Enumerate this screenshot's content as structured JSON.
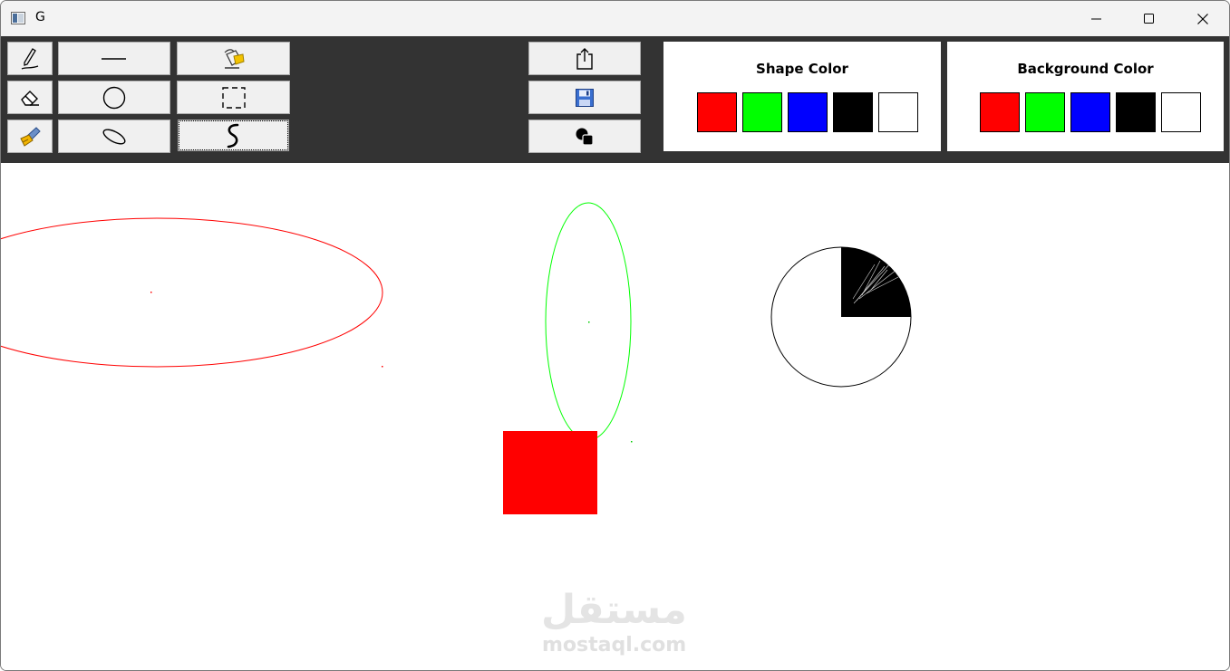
{
  "window": {
    "title": "G"
  },
  "toolbar": {
    "tools": [
      {
        "name": "pencil",
        "icon": "pencil-icon"
      },
      {
        "name": "line",
        "icon": "line-icon"
      },
      {
        "name": "bucket-fill",
        "icon": "paint-bucket-icon"
      },
      {
        "name": "eraser",
        "icon": "eraser-icon"
      },
      {
        "name": "circle",
        "icon": "circle-icon"
      },
      {
        "name": "rectangle-select",
        "icon": "dashed-rectangle-icon"
      },
      {
        "name": "brush",
        "icon": "brush-icon"
      },
      {
        "name": "ellipse",
        "icon": "ellipse-icon"
      },
      {
        "name": "freeform",
        "icon": "squiggle-icon",
        "selected": true
      }
    ],
    "actions": [
      {
        "name": "export",
        "icon": "export-icon"
      },
      {
        "name": "save",
        "icon": "save-icon"
      },
      {
        "name": "shapes",
        "icon": "shapes-icon"
      }
    ]
  },
  "shape_color": {
    "title": "Shape Color",
    "swatches": [
      "#ff0000",
      "#00ff00",
      "#0000ff",
      "#000000",
      "#ffffff"
    ]
  },
  "background_color": {
    "title": "Background Color",
    "swatches": [
      "#ff0000",
      "#00ff00",
      "#0000ff",
      "#000000",
      "#ffffff"
    ]
  },
  "canvas": {
    "shapes": [
      {
        "type": "ellipse",
        "stroke": "#ff0000"
      },
      {
        "type": "ellipse",
        "stroke": "#00ff00"
      },
      {
        "type": "rectangle",
        "fill": "#ff0000"
      },
      {
        "type": "pie-circle",
        "stroke": "#000000",
        "fill": "#000000"
      }
    ]
  },
  "watermark": {
    "arabic": "مستقل",
    "latin": "mostaql.com"
  }
}
